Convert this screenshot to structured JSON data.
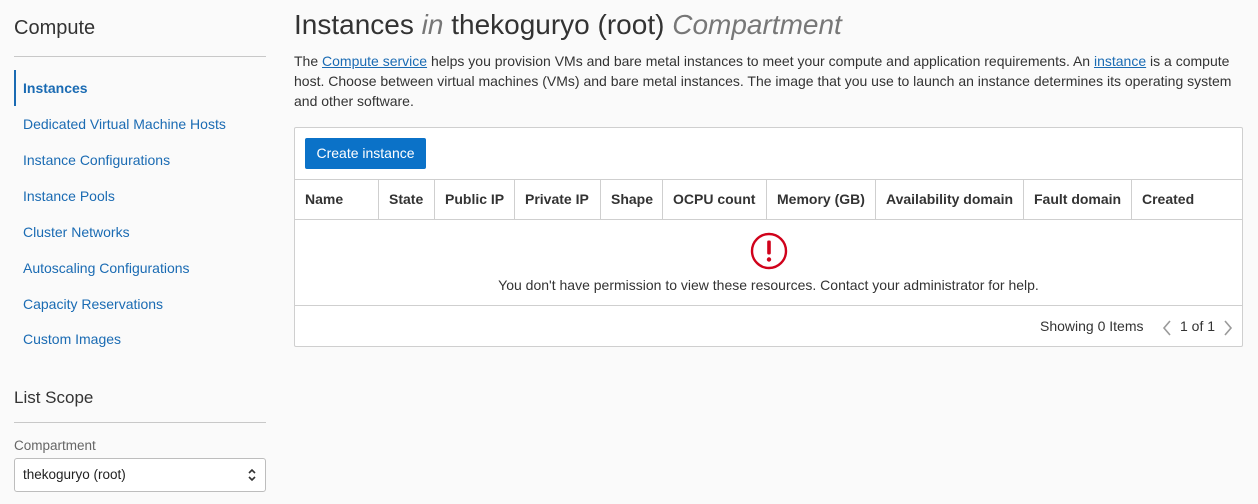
{
  "sidebar": {
    "title": "Compute",
    "items": [
      {
        "label": "Instances",
        "active": true
      },
      {
        "label": "Dedicated Virtual Machine Hosts"
      },
      {
        "label": "Instance Configurations"
      },
      {
        "label": "Instance Pools"
      },
      {
        "label": "Cluster Networks"
      },
      {
        "label": "Autoscaling Configurations"
      },
      {
        "label": "Capacity Reservations"
      },
      {
        "label": "Custom Images"
      }
    ],
    "list_scope": {
      "title": "List Scope",
      "compartment_label": "Compartment",
      "compartment_value": "thekoguryo (root)"
    }
  },
  "main": {
    "title": {
      "part1": "Instances",
      "in": "in",
      "compartment": "thekoguryo (root)",
      "suffix": "Compartment"
    },
    "description": {
      "t1": "The ",
      "link1": "Compute service",
      "t2": " helps you provision VMs and bare metal instances to meet your compute and application requirements. An ",
      "link2": "instance",
      "t3": " is a compute host. Choose between virtual machines (VMs) and bare metal instances. The image that you use to launch an instance determines its operating system and other software."
    },
    "create_button": "Create instance",
    "columns": [
      "Name",
      "State",
      "Public IP",
      "Private IP",
      "Shape",
      "OCPU count",
      "Memory (GB)",
      "Availability domain",
      "Fault domain",
      "Created"
    ],
    "empty_message": "You don't have permission to view these resources. Contact your administrator for help.",
    "pagination": {
      "showing": "Showing 0 Items",
      "page": "1 of 1"
    }
  },
  "colors": {
    "link": "#1a6bb3",
    "primary_button": "#0b72c8",
    "error_icon": "#d0021b"
  },
  "icons": {
    "error": "exclamation-circle-icon",
    "select": "chevron-up-down-icon",
    "prev": "chevron-left-icon",
    "next": "chevron-right-icon"
  }
}
